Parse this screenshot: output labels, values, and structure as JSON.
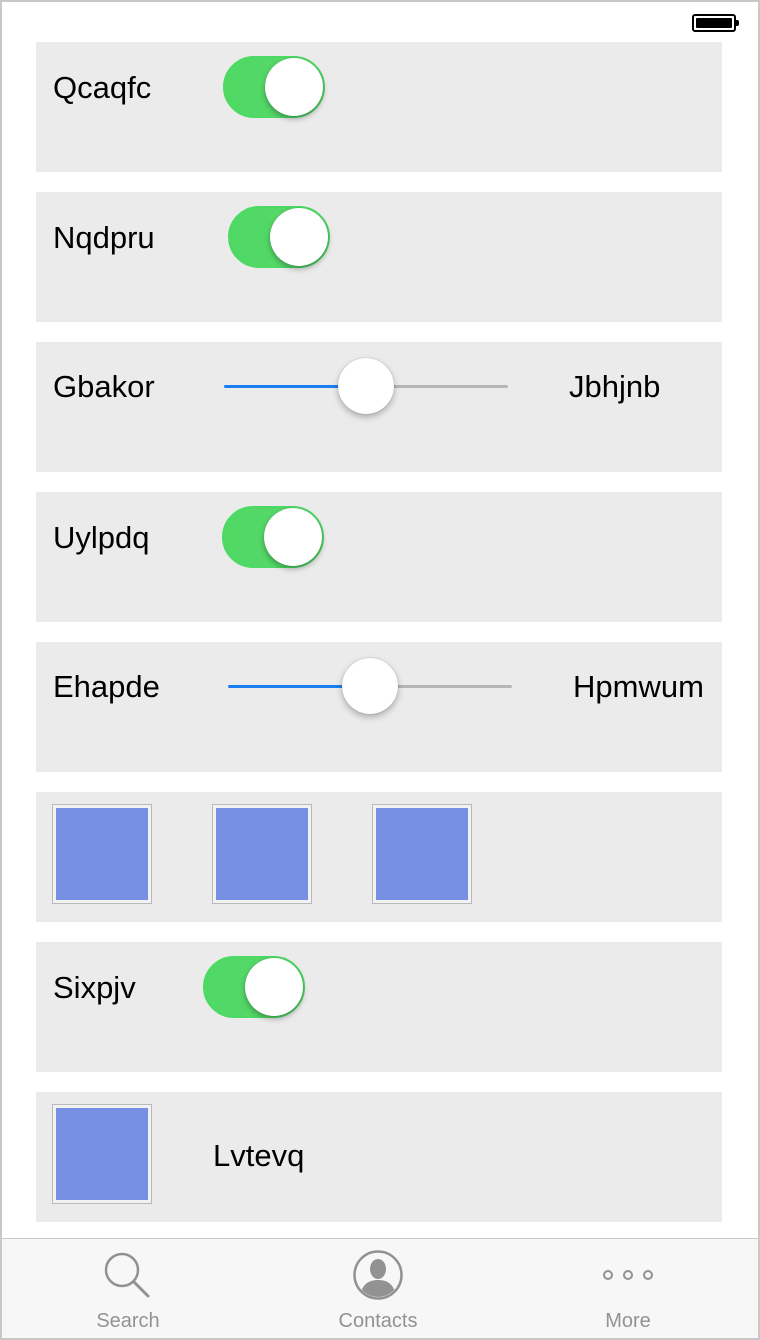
{
  "status_bar": {
    "battery": "full"
  },
  "rows": [
    {
      "type": "switch",
      "label": "Qcaqfc",
      "on": true
    },
    {
      "type": "switch",
      "label": "Nqdpru",
      "on": true
    },
    {
      "type": "slider",
      "label": "Gbakor",
      "value_label": "Jbhjnb",
      "value": 0.5
    },
    {
      "type": "switch",
      "label": "Uylpdq",
      "on": true
    },
    {
      "type": "slider",
      "label": "Ehapde",
      "value_label": "Hpmwum",
      "value": 0.5
    },
    {
      "type": "images",
      "count": 3
    },
    {
      "type": "switch",
      "label": "Sixpjv",
      "on": true
    },
    {
      "type": "image-label",
      "label": "Lvtevq"
    }
  ],
  "tabbar": {
    "tabs": [
      {
        "label": "Search",
        "icon": "search-icon"
      },
      {
        "label": "Contacts",
        "icon": "contacts-icon"
      },
      {
        "label": "More",
        "icon": "more-icon"
      }
    ]
  },
  "colors": {
    "switch_on": "#4cd964",
    "slider_min_track": "#1a7ff2",
    "slider_max_track": "#b6b6b6",
    "cell_background": "#ebebeb",
    "image_fill": "#7890e3",
    "tab_inactive": "#929292"
  }
}
